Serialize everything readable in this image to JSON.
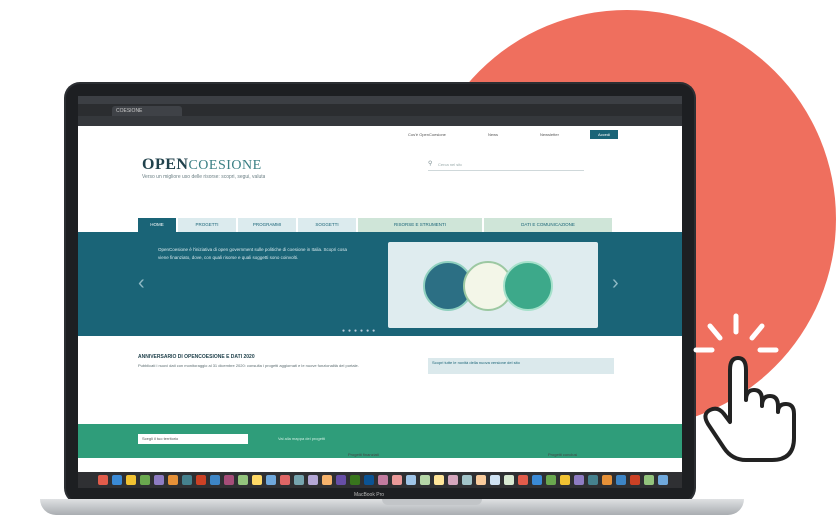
{
  "site": {
    "logo_bold": "OPEN",
    "logo_rest": "COESIONE",
    "tagline": "Verso un migliore uso delle risorse: scopri, segui, valuta",
    "search_placeholder": "Cerca nel sito",
    "utility_links": [
      "Cos'è OpenCoesione",
      "News",
      "Newsletter"
    ],
    "login_label": "Accedi"
  },
  "nav": {
    "items": [
      {
        "label": "HOME",
        "active": true
      },
      {
        "label": "PROGETTI",
        "active": false
      },
      {
        "label": "PROGRAMMI",
        "active": false
      },
      {
        "label": "SOGGETTI",
        "active": false
      },
      {
        "label": "RISORSE E STRUMENTI",
        "active": false
      },
      {
        "label": "DATI E COMUNICAZIONE",
        "active": false
      }
    ]
  },
  "hero": {
    "text": "OpenCoesione è l'iniziativa di open government sulle politiche di coesione in Italia. Scopri cosa viene finanziato, dove, con quali risorse e quali soggetti sono coinvolti.",
    "figure_labels": [
      "",
      "",
      ""
    ]
  },
  "info": {
    "title": "ANNIVERSARIO DI OPENCOESIONE E DATI 2020",
    "text": "Pubblicati i nuovi dati con monitoraggio al 31 dicembre 2020: consulta i progetti aggiornati e le nuove funzionalità del portale.",
    "box": "Scopri tutte le novità della nuova versione del sito"
  },
  "green_band": {
    "select_value": "Scegli il tuo territorio",
    "label": "Vai alla mappa dei progetti"
  },
  "sections": {
    "left": "Progetti finanziati",
    "right": "Progetti conclusi"
  },
  "dock_label": "MacBook Pro",
  "colors": {
    "accent": "#1a6477",
    "green": "#2f9d7a",
    "coral": "#ef6f5e"
  }
}
